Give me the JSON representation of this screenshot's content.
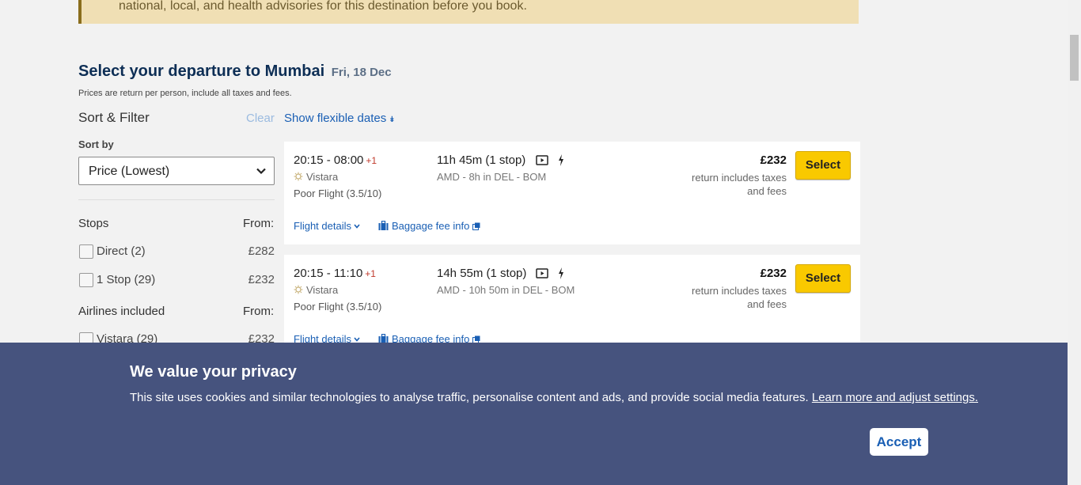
{
  "advisory": {
    "text": "national, local, and health advisories for this destination before you book."
  },
  "header": {
    "title": "Select your departure to Mumbai",
    "date": "Fri, 18 Dec",
    "price_note": "Prices are return per person, include all taxes and fees."
  },
  "filters": {
    "title": "Sort & Filter",
    "clear_label": "Clear",
    "flexible_dates_label": "Show flexible dates",
    "sort_label": "Sort by",
    "sort_value": "Price (Lowest)",
    "stops": {
      "title": "Stops",
      "from_label": "From:",
      "options": [
        {
          "label": "Direct (2)",
          "price": "£282"
        },
        {
          "label": "1 Stop (29)",
          "price": "£232"
        }
      ]
    },
    "airlines": {
      "title": "Airlines included",
      "from_label": "From:",
      "options": [
        {
          "label": "Vistara (29)",
          "price": "£232"
        }
      ]
    }
  },
  "flights": [
    {
      "times": "20:15 - 08:00",
      "day_offset": "+1",
      "airline": "Vistara",
      "rating": "Poor Flight (3.5/10)",
      "duration": "11h 45m (1 stop)",
      "route": "AMD - 8h in DEL - BOM",
      "price": "£232",
      "price_note": "return includes taxes and fees",
      "select_label": "Select",
      "details_label": "Flight details",
      "baggage_label": "Baggage fee info"
    },
    {
      "times": "20:15 - 11:10",
      "day_offset": "+1",
      "airline": "Vistara",
      "rating": "Poor Flight (3.5/10)",
      "duration": "14h 55m (1 stop)",
      "route": "AMD - 10h 50m in DEL - BOM",
      "price": "£232",
      "price_note": "return includes taxes and fees",
      "select_label": "Select",
      "details_label": "Flight details",
      "baggage_label": "Baggage fee info"
    }
  ],
  "cookie": {
    "title": "We value your privacy",
    "text": "This site uses cookies and similar technologies to analyse traffic, personalise content and ads, and provide social media features.",
    "link_label": "Learn more and adjust settings.",
    "accept_label": "Accept"
  },
  "icons": [
    "chevron-down-icon",
    "double-chevron-down-icon",
    "screen-icon",
    "power-icon",
    "airline-logo-icon",
    "baggage-icon",
    "external-link-icon"
  ],
  "colors": {
    "brand_navy": "#0d2e55",
    "link": "#1a5fb4",
    "select_button": "#f9c900",
    "cookie_banner": "#46537e",
    "advisory_bg": "#f0dfb4"
  }
}
